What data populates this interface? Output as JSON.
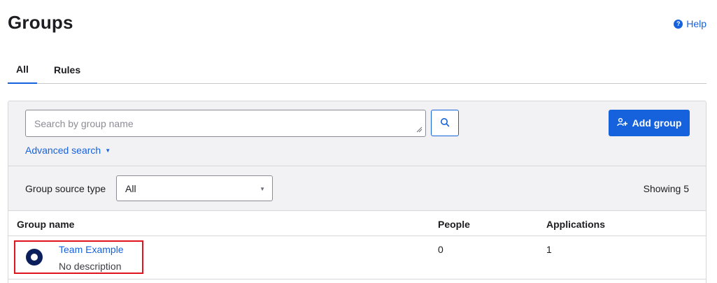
{
  "header": {
    "title": "Groups",
    "help_label": "Help",
    "help_icon_glyph": "?"
  },
  "tabs": [
    {
      "label": "All",
      "active": true
    },
    {
      "label": "Rules",
      "active": false
    }
  ],
  "search": {
    "placeholder": "Search by group name",
    "value": "",
    "advanced_label": "Advanced search",
    "advanced_caret": "▼"
  },
  "actions": {
    "add_group_label": "Add group"
  },
  "filter": {
    "label": "Group source type",
    "selected": "All",
    "caret": "▼",
    "showing_text": "Showing 5"
  },
  "table": {
    "columns": [
      "Group name",
      "People",
      "Applications"
    ],
    "rows": [
      {
        "name": "Team Example",
        "description": "No description",
        "people": "0",
        "applications": "1"
      }
    ]
  },
  "colors": {
    "accent": "#1662dd",
    "highlight": "#e0141e",
    "avatar": "#0a1f5c"
  },
  "icons": {
    "help": "help-circle-icon",
    "search": "magnifier-icon",
    "add_group": "add-people-icon",
    "avatar": "group-avatar-icon"
  }
}
